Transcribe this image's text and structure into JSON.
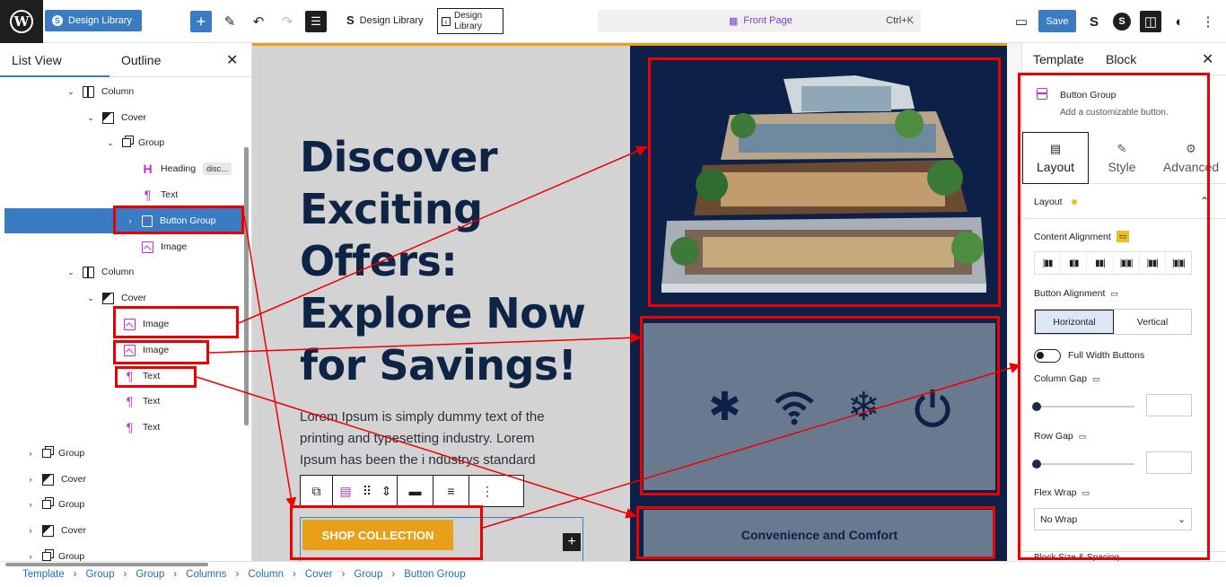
{
  "topbar": {
    "site_button": "Design Library",
    "doc_title": "Design Library",
    "template_box": "Design\nLibrary",
    "command": {
      "label": "Front Page",
      "shortcut": "Ctrl+K"
    },
    "save": "Save"
  },
  "left_panel": {
    "tabs": [
      "List View",
      "Outline"
    ],
    "rows": [
      {
        "label": "Column",
        "icon": "column-icon"
      },
      {
        "label": "Cover",
        "icon": "cover-icon"
      },
      {
        "label": "Group",
        "icon": "group-icon"
      },
      {
        "label": "Heading",
        "icon": "heading-icon",
        "badge": "disc..."
      },
      {
        "label": "Text",
        "icon": "paragraph-icon"
      },
      {
        "label": "Button Group",
        "icon": "button-group-icon"
      },
      {
        "label": "Image",
        "icon": "image-icon"
      },
      {
        "label": "Column",
        "icon": "column-icon"
      },
      {
        "label": "Cover",
        "icon": "cover-icon"
      },
      {
        "label": "Image",
        "icon": "image-icon"
      },
      {
        "label": "Image",
        "icon": "image-icon"
      },
      {
        "label": "Text",
        "icon": "paragraph-icon"
      },
      {
        "label": "Text",
        "icon": "paragraph-icon"
      },
      {
        "label": "Text",
        "icon": "paragraph-icon"
      },
      {
        "label": "Group",
        "icon": "group-icon"
      },
      {
        "label": "Cover",
        "icon": "cover-icon"
      },
      {
        "label": "Group",
        "icon": "group-icon"
      },
      {
        "label": "Cover",
        "icon": "cover-icon"
      },
      {
        "label": "Group",
        "icon": "group-icon"
      }
    ]
  },
  "canvas": {
    "heading": "Discover Exciting Offers: Explore Now for Savings!",
    "paragraph": "Lorem Ipsum is simply dummy text of the printing and typesetting industry. Lorem Ipsum has been the i ndustrys standard",
    "button": "SHOP COLLECTION",
    "convenience": "Convenience and Comfort",
    "accent": "#e8a018",
    "dark_navy": "#0d2148"
  },
  "right_panel": {
    "tabs": [
      "Template",
      "Block"
    ],
    "block_title": "Button Group",
    "block_desc": "Add a customizable button.",
    "sub_tabs": [
      "Layout",
      "Style",
      "Advanced"
    ],
    "section": "Layout",
    "content_alignment": "Content Alignment",
    "button_alignment": "Button Alignment",
    "alignment_options": [
      "Horizontal",
      "Vertical"
    ],
    "full_width": "Full Width Buttons",
    "column_gap": "Column Gap",
    "row_gap": "Row Gap",
    "flex_wrap": "Flex Wrap",
    "flex_wrap_value": "No Wrap",
    "next_section": "Block Size & Spacing"
  },
  "breadcrumb": [
    "Template",
    "Group",
    "Group",
    "Columns",
    "Column",
    "Cover",
    "Group",
    "Button Group"
  ]
}
